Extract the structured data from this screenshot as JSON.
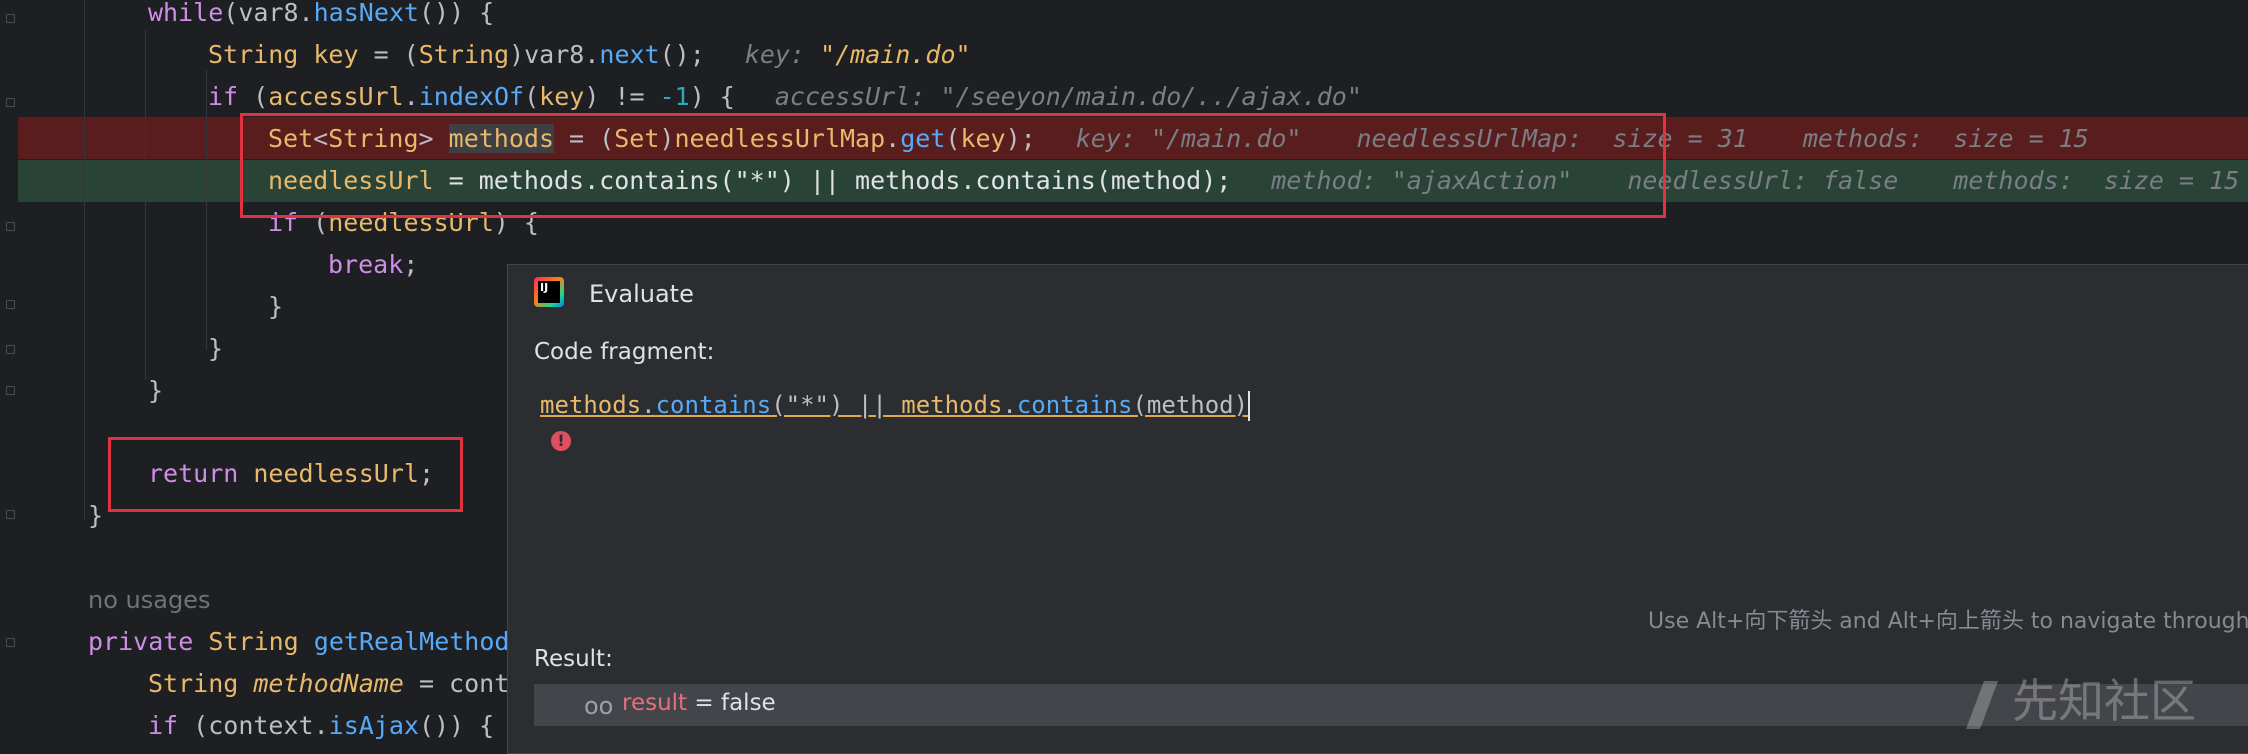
{
  "editor": {
    "lines": {
      "l1": {
        "kw": "while",
        "p1": "(",
        "obj": "var8",
        "dot": ".",
        "fn": "hasNext",
        "p2": "()) {"
      },
      "l2": {
        "type": "String",
        "sp": " ",
        "var": "key",
        "p1": " = (",
        "type2": "String",
        "p2": ")",
        "obj": "var8",
        "dot": ".",
        "fn": "next",
        "p3": "();",
        "hint_name": "key: ",
        "hint_val": "\"/main.do\""
      },
      "l3": {
        "kw": "if",
        "p1": " (",
        "obj": "accessUrl",
        "dot": ".",
        "fn": "indexOf",
        "p2": "(",
        "var": "key",
        "p3": ") != ",
        "num": "-1",
        "p4": ") {",
        "hint_name": "accessUrl: ",
        "hint_val": "\"/seeyon/main.do/../ajax.do\""
      },
      "l4": {
        "type": "Set",
        "p1": "<",
        "type2": "String",
        "p2": "> ",
        "var": "methods",
        "p3": " = (",
        "type3": "Set",
        "p4": ")",
        "fld": "needlessUrlMap",
        "dot": ".",
        "fn": "get",
        "p5": "(",
        "arg": "key",
        "p6": ");",
        "hint1": "key: \"/main.do\"",
        "hint2": "needlessUrlMap:  size = 31",
        "hint3": "methods:  size = 15"
      },
      "l5": {
        "var": "needlessUrl",
        "code": " = methods.contains(\"*\") || methods.contains(method);",
        "hint1": "method: \"ajaxAction\"",
        "hint2": "needlessUrl: false",
        "hint3": "methods:  size = 15"
      },
      "l6": {
        "kw": "if",
        "p1": " (",
        "var": "needlessUrl",
        "p2": ") {"
      },
      "l7": {
        "kw": "break",
        "p1": ";"
      },
      "l8": {
        "p1": "}"
      },
      "l9": {
        "p1": "}"
      },
      "l10": {
        "p1": "}"
      },
      "l11": {
        "kw": "return",
        "sp": " ",
        "var": "needlessUrl",
        "p1": ";"
      },
      "l12": {
        "p1": "}"
      },
      "usages": "no usages",
      "l13": {
        "kw": "private",
        "sp": " ",
        "type": "String",
        "sp2": " ",
        "fn": "getRealMethod"
      },
      "l14": {
        "type": "String",
        "sp": " ",
        "var": "methodName",
        "p1": " = cont"
      },
      "l15": {
        "kw": "if",
        "p1": " (",
        "obj": "context",
        "dot": ".",
        "fn": "isAjax",
        "p2": "()) {"
      }
    }
  },
  "dialog": {
    "title": "Evaluate",
    "icon_text": "IJ",
    "code_label": "Code fragment:",
    "code": {
      "m1": "methods",
      "d1": ".",
      "f1": "contains",
      "a1": "(\"*\")",
      "op": " || ",
      "m2": "methods",
      "d2": ".",
      "f2": "contains",
      "a2": "(method)"
    },
    "nav_hint": "Use Alt+向下箭头 and Alt+向上箭头 to navigate through t",
    "result_label": "Result:",
    "result": {
      "icon": "oo",
      "name": "result",
      "eq": " = ",
      "value": "false"
    }
  },
  "watermark": "先知社区",
  "colors": {
    "highlight_red": "#5a1d1d",
    "highlight_green": "#294436",
    "box_red": "#e0333f"
  }
}
